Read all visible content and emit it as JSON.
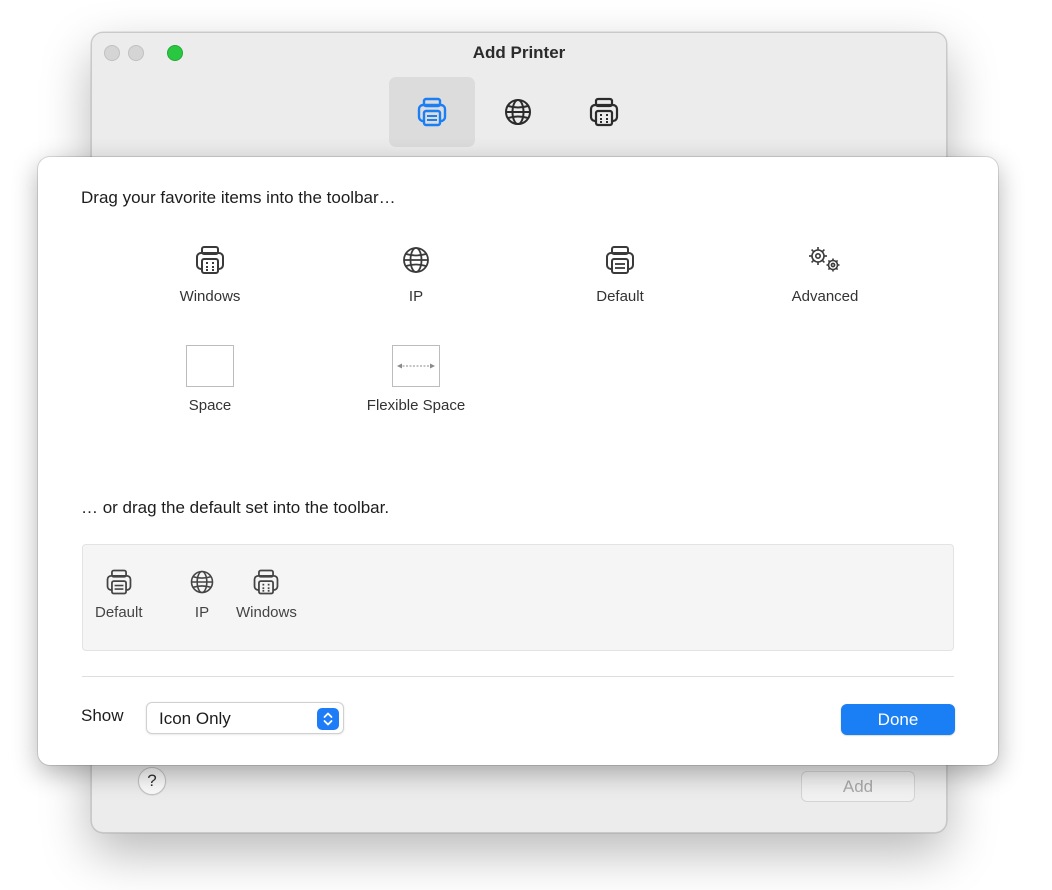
{
  "window": {
    "title": "Add Printer",
    "add_label": "Add",
    "help_label": "?"
  },
  "sheet": {
    "heading_items": "Drag your favorite items into the toolbar…",
    "heading_default": "… or drag the default set into the toolbar.",
    "palette": [
      {
        "label": "Windows",
        "icon": "windows-printer-icon"
      },
      {
        "label": "IP",
        "icon": "globe-icon"
      },
      {
        "label": "Default",
        "icon": "printer-icon"
      },
      {
        "label": "Advanced",
        "icon": "gears-icon"
      },
      {
        "label": "Space",
        "icon": "space-icon"
      },
      {
        "label": "Flexible Space",
        "icon": "flexible-space-icon"
      }
    ],
    "default_set": [
      {
        "label": "Default"
      },
      {
        "label": "IP"
      },
      {
        "label": "Windows"
      }
    ],
    "show_label": "Show",
    "show_value": "Icon Only",
    "done_label": "Done"
  },
  "colors": {
    "accent": "#1a7ef5",
    "zoom_button": "#2ac840"
  }
}
